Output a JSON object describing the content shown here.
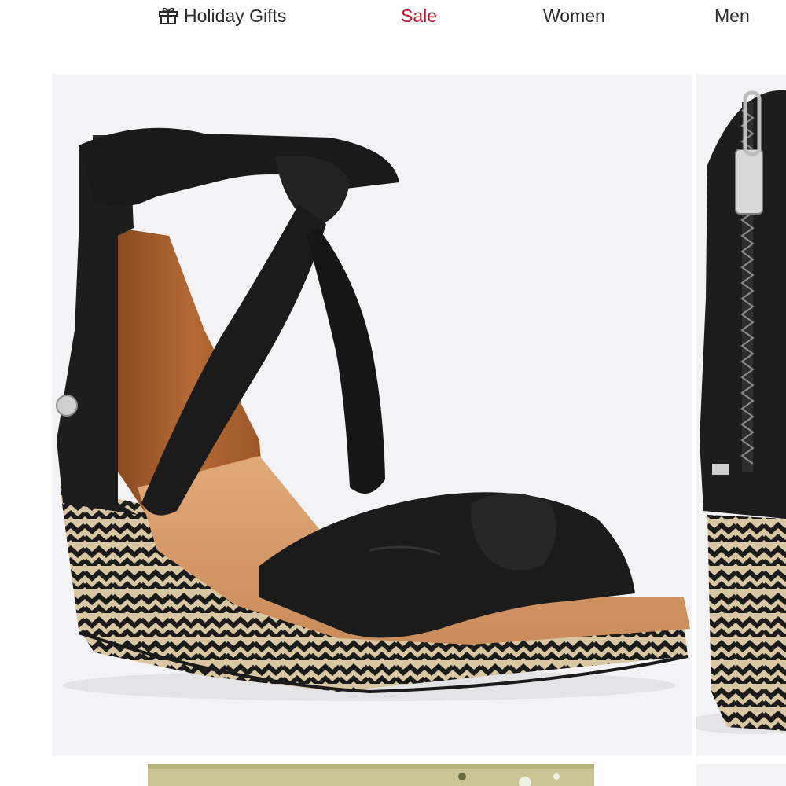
{
  "nav": {
    "items": [
      {
        "label": "Holiday Gifts",
        "icon": "gift-icon"
      },
      {
        "label": "Sale",
        "color": "#c8102e"
      },
      {
        "label": "Women"
      },
      {
        "label": "Men"
      }
    ]
  },
  "product": {
    "image": "black-wedge-espadrille-sandal",
    "next_image": "sandal-back-zipper-view"
  },
  "colors": {
    "sale_accent": "#c8102e",
    "image_bg": "#f3f3f5"
  }
}
